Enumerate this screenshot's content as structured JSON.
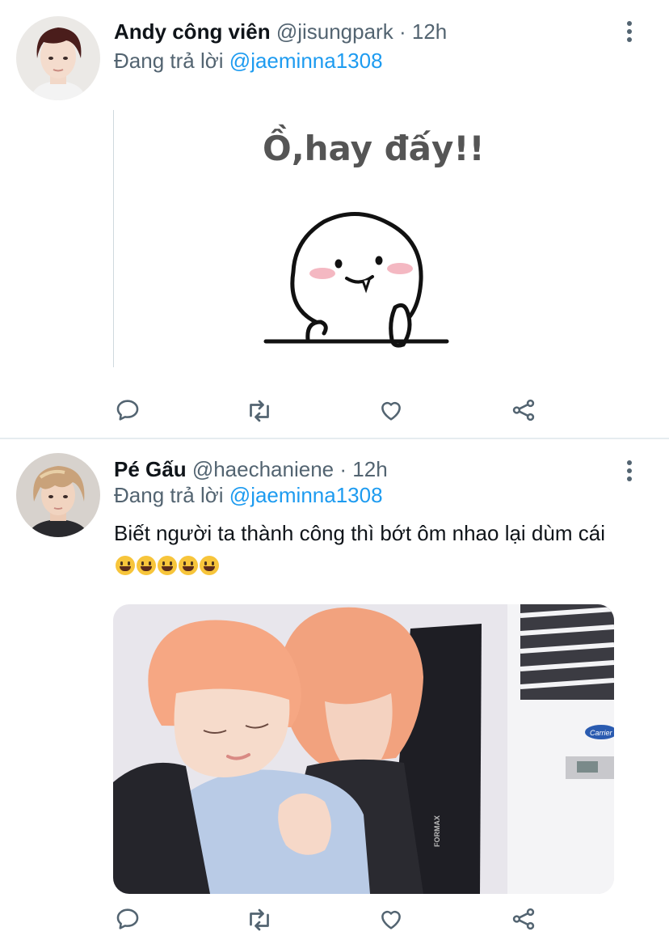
{
  "tweets": [
    {
      "author_name": "Andy công viên",
      "handle": "@jisungpark",
      "separator": "·",
      "time": "12h",
      "reply_prefix": "Đang trả lời",
      "reply_to": "@jaeminna1308",
      "media": {
        "caption_text": "Ồ,hay đấy!!",
        "colors": {
          "text": "#555555",
          "line": "#111111",
          "cheeks": "#f4b8c2"
        }
      }
    },
    {
      "author_name": "Pé Gấu",
      "handle": "@haechaniene",
      "separator": "·",
      "time": "12h",
      "reply_prefix": "Đang trả lời",
      "reply_to": "@jaeminna1308",
      "text": "Biết người ta thành công thì bớt ôm nhao lại dùm cái",
      "emoji_count": 5,
      "media": {
        "unit_brand": "Carrier",
        "speaker_brand": "FORMAX",
        "colors": {
          "hair": "#f2a27e",
          "wall": "#e8e6ec",
          "shirt": "#b9cbe6",
          "dark": "#1e1e24"
        }
      }
    }
  ],
  "icons": [
    "reply-icon",
    "retweet-icon",
    "like-icon",
    "share-icon",
    "more-icon"
  ],
  "colors": {
    "accent": "#1d9bf0",
    "secondary_text": "#536471",
    "primary_text": "#0f1419",
    "divider": "#e6ecf0"
  }
}
